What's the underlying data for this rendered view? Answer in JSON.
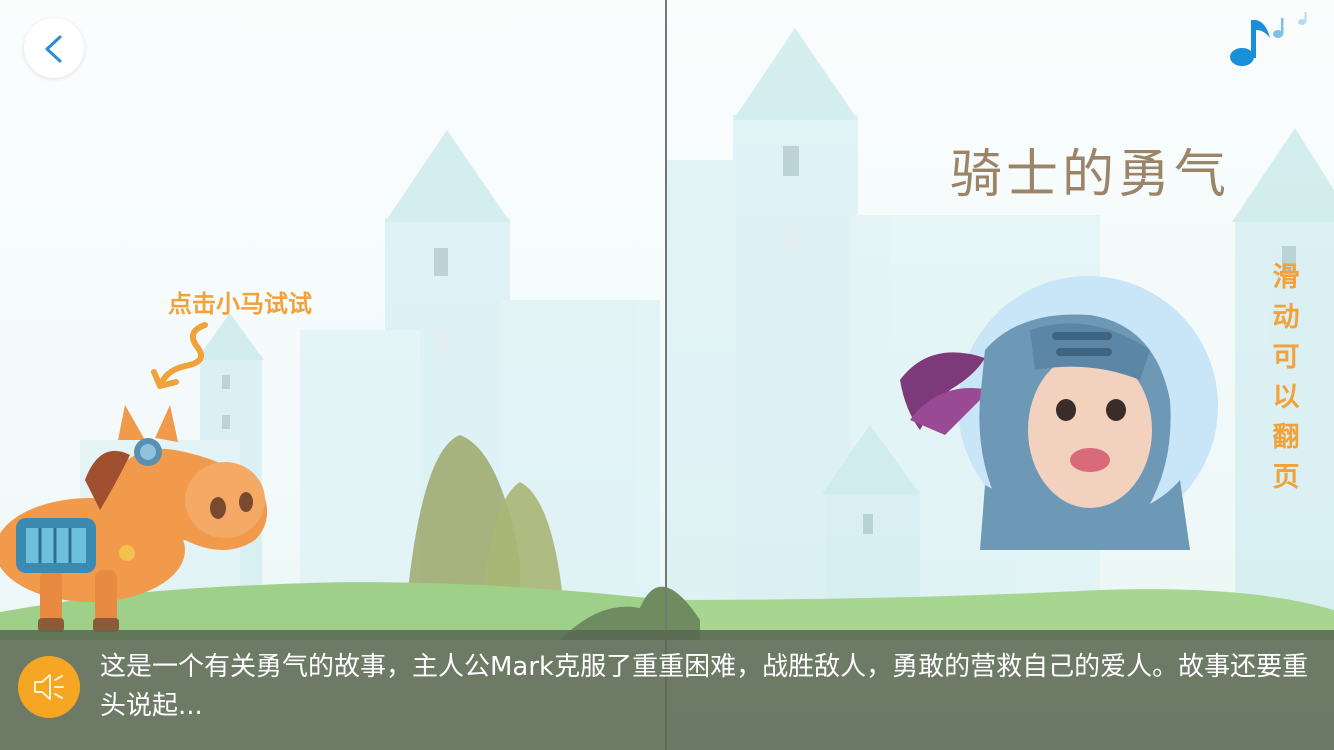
{
  "book": {
    "title": "骑士的勇气",
    "tap_hint": "点击小马试试",
    "swipe_hint_chars": [
      "滑",
      "动",
      "可",
      "以",
      "翻",
      "页"
    ]
  },
  "caption": {
    "text": "这是一个有关勇气的故事，主人公Mark克服了重重困难，战胜敌人，勇敢的营救自己的爱人。故事还要重头说起..."
  },
  "icons": {
    "back": "chevron-left-icon",
    "music": "music-notes-icon",
    "speaker": "speaker-icon",
    "arrow": "squiggle-arrow-icon"
  },
  "colors": {
    "accent_orange": "#f5a623",
    "hint_orange": "#f2a23b",
    "title_brown": "#9c8468",
    "back_blue": "#2d8ad8",
    "music_blue": "#1a8fd9",
    "caption_bg": "#5a6952"
  }
}
